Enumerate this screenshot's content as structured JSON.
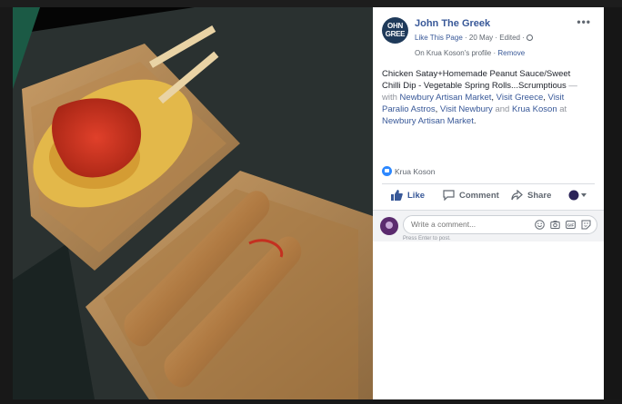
{
  "photo": {
    "description_alt": "Chicken satay with peanut sauce and spring rolls"
  },
  "post": {
    "avatar_text": "OHN\nGREE",
    "page_name": "John The Greek",
    "like_page": "Like This Page",
    "date": "20 May",
    "edited": "Edited",
    "sep": "·",
    "profile_prefix": "On Krua Koson's profile",
    "remove": "Remove",
    "more": "•••",
    "text_main": "Chicken Satay+Homemade Peanut Sauce/Sweet Chilli Dip - Vegetable Spring Rolls...Scrumptious",
    "text_dash": " — with ",
    "tag1": "Newbury Artisan Market",
    "tag2": "Visit Greece",
    "tag3": "Visit Paralio Astros",
    "tag4": "Visit Newbury",
    "and": " and ",
    "tag5": "Krua Koson",
    "at": " at ",
    "location": "Newbury Artisan Market",
    "period": "."
  },
  "reactions": {
    "names": "Krua Koson"
  },
  "actions": {
    "like": "Like",
    "comment": "Comment",
    "share": "Share"
  },
  "comment_box": {
    "placeholder": "Write a comment...",
    "hint": "Press Enter to post."
  },
  "icons": {
    "like": "thumbs-up-icon",
    "comment": "speech-bubble-icon",
    "share": "share-arrow-icon",
    "emoji": "smiley-icon",
    "camera": "camera-icon",
    "gif": "gif-icon",
    "sticker": "sticker-icon",
    "globe": "globe-icon"
  },
  "colors": {
    "link": "#385898",
    "accent": "#2d88ff",
    "panel": "#ffffff"
  }
}
